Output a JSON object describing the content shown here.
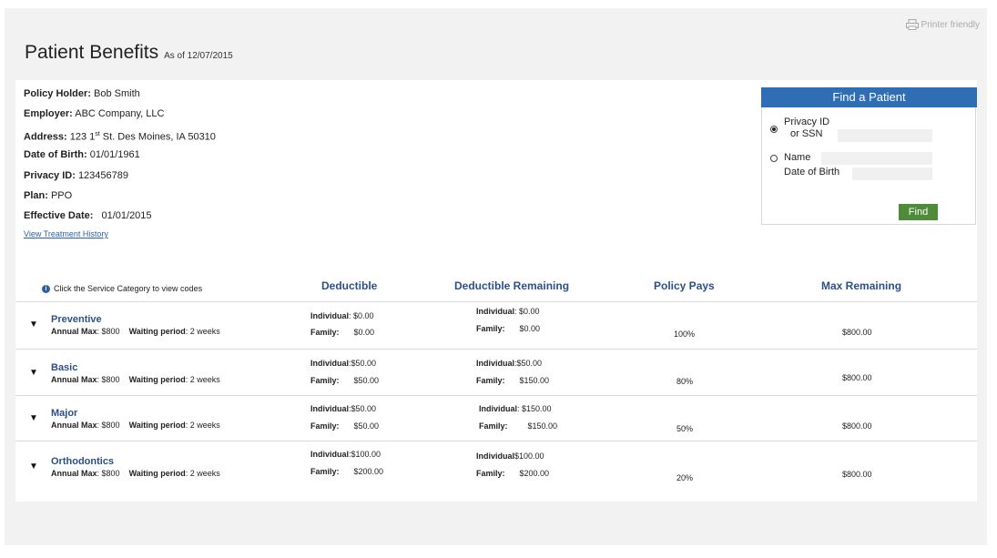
{
  "header": {
    "printer_label": "Printer friendly",
    "title": "Patient Benefits",
    "as_of": "As of 12/07/2015"
  },
  "policy": {
    "holder_label": "Policy Holder:",
    "holder": "Bob Smith",
    "employer_label": "Employer:",
    "employer": "ABC Company, LLC",
    "address_label": "Address:",
    "address_num": "123 1",
    "address_sup": "st",
    "address_rest": " St. Des Moines, IA 50310",
    "dob_label": "Date of Birth:",
    "dob": "01/01/1961",
    "privacy_label": "Privacy ID:",
    "privacy": "123456789",
    "plan_label": "Plan:",
    "plan": "PPO",
    "effective_label": "Effective Date:",
    "effective": "01/01/2015",
    "history_link": "View Treatment History"
  },
  "find_patient": {
    "title": "Find a Patient",
    "privacy_label_1": "Privacy ID",
    "privacy_label_2": "or SSN",
    "name_label": "Name",
    "dob_label": "Date of Birth",
    "privacy_value": "",
    "name_value": "",
    "dob_value": "",
    "button": "Find",
    "selected": "privacy"
  },
  "table": {
    "hint": "Click the Service Category to view codes",
    "headers": {
      "deductible": "Deductible",
      "remaining": "Deductible Remaining",
      "policy_pays": "Policy Pays",
      "max_remaining": "Max Remaining"
    },
    "individual_label": "Individual",
    "family_label": "Family:",
    "annual_max_label": "Annual Max",
    "waiting_label": "Waiting period",
    "rows": [
      {
        "name": "Preventive",
        "annual_max": ": $800",
        "waiting": ": 2 weeks",
        "ded_ind": ": $0.00",
        "ded_fam": "$0.00",
        "rem_ind": ": $0.00",
        "rem_fam": "$0.00",
        "pays": "100%",
        "max_rem": "$800.00"
      },
      {
        "name": "Basic",
        "annual_max": ": $800",
        "waiting": ": 2 weeks",
        "ded_ind": ":$50.00",
        "ded_fam": "$50.00",
        "rem_ind": ":$50.00",
        "rem_fam": "$150.00",
        "pays": "80%",
        "max_rem": "$800.00"
      },
      {
        "name": "Major",
        "annual_max": ": $800",
        "waiting": ": 2 weeks",
        "ded_ind": ":$50.00",
        "ded_fam": "$50.00",
        "rem_ind": ": $150.00",
        "rem_fam": "$150.00",
        "pays": "50%",
        "max_rem": "$800.00"
      },
      {
        "name": "Orthodontics",
        "annual_max": ": $800",
        "waiting": ": 2 weeks",
        "ded_ind": ":$100.00",
        "ded_fam": "$200.00",
        "rem_ind": "$100.00",
        "rem_fam": "$200.00",
        "pays": "20%",
        "max_rem": "$800.00"
      }
    ]
  }
}
